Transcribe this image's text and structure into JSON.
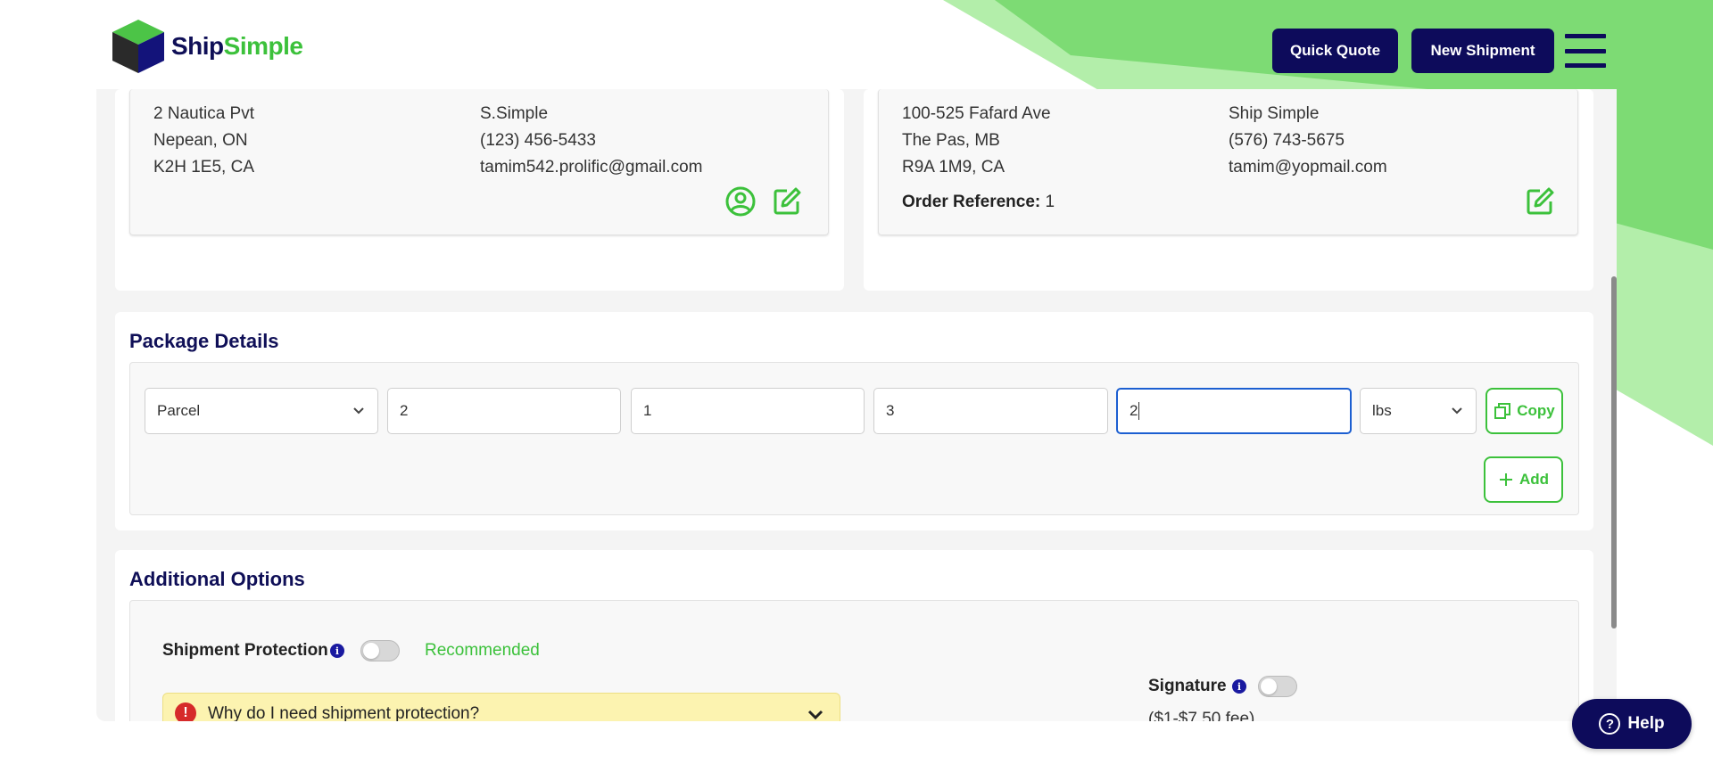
{
  "brand": {
    "name_part1": "Ship",
    "name_part2": "Simple",
    "primary": "#0d0b5b",
    "accent": "#3cc13b"
  },
  "header": {
    "quick_quote": "Quick Quote",
    "new_shipment": "New Shipment"
  },
  "from": {
    "address_line1": "2 Nautica Pvt",
    "address_line2": "Nepean, ON",
    "address_line3": "K2H 1E5, CA",
    "contact_name": "S.Simple",
    "phone": "(123) 456-5433",
    "email": "tamim542.prolific@gmail.com"
  },
  "to": {
    "address_line1": "100-525 Fafard Ave",
    "address_line2": "The Pas, MB",
    "address_line3": "R9A 1M9, CA",
    "contact_name": "Ship Simple",
    "phone": "(576) 743-5675",
    "email": "tamim@yopmail.com",
    "order_ref_label": "Order Reference:",
    "order_ref_value": "1"
  },
  "package_details": {
    "title": "Package Details",
    "package_type": "Parcel",
    "length": "2",
    "width": "1",
    "height": "3",
    "weight": "2",
    "unit": "lbs",
    "copy_label": "Copy",
    "add_label": "Add"
  },
  "additional_options": {
    "title": "Additional Options",
    "protection_label": "Shipment Protection",
    "recommended": "Recommended",
    "faq_question": "Why do I need shipment protection?",
    "signature_label": "Signature",
    "signature_fee": "($1-$7.50 fee)"
  },
  "help": {
    "label": "Help"
  }
}
